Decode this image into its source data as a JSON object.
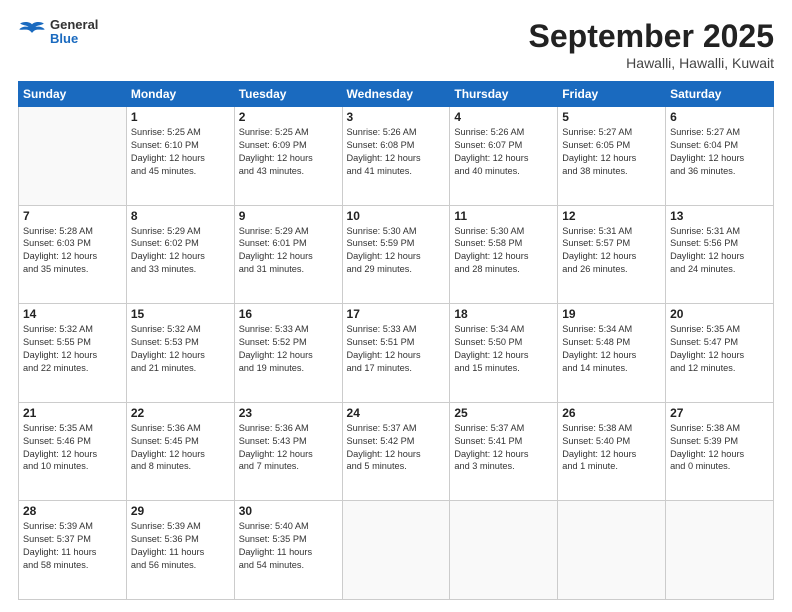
{
  "header": {
    "logo_line1": "General",
    "logo_line2": "Blue",
    "month": "September 2025",
    "location": "Hawalli, Hawalli, Kuwait"
  },
  "weekdays": [
    "Sunday",
    "Monday",
    "Tuesday",
    "Wednesday",
    "Thursday",
    "Friday",
    "Saturday"
  ],
  "weeks": [
    [
      {
        "day": "",
        "info": ""
      },
      {
        "day": "1",
        "info": "Sunrise: 5:25 AM\nSunset: 6:10 PM\nDaylight: 12 hours\nand 45 minutes."
      },
      {
        "day": "2",
        "info": "Sunrise: 5:25 AM\nSunset: 6:09 PM\nDaylight: 12 hours\nand 43 minutes."
      },
      {
        "day": "3",
        "info": "Sunrise: 5:26 AM\nSunset: 6:08 PM\nDaylight: 12 hours\nand 41 minutes."
      },
      {
        "day": "4",
        "info": "Sunrise: 5:26 AM\nSunset: 6:07 PM\nDaylight: 12 hours\nand 40 minutes."
      },
      {
        "day": "5",
        "info": "Sunrise: 5:27 AM\nSunset: 6:05 PM\nDaylight: 12 hours\nand 38 minutes."
      },
      {
        "day": "6",
        "info": "Sunrise: 5:27 AM\nSunset: 6:04 PM\nDaylight: 12 hours\nand 36 minutes."
      }
    ],
    [
      {
        "day": "7",
        "info": "Sunrise: 5:28 AM\nSunset: 6:03 PM\nDaylight: 12 hours\nand 35 minutes."
      },
      {
        "day": "8",
        "info": "Sunrise: 5:29 AM\nSunset: 6:02 PM\nDaylight: 12 hours\nand 33 minutes."
      },
      {
        "day": "9",
        "info": "Sunrise: 5:29 AM\nSunset: 6:01 PM\nDaylight: 12 hours\nand 31 minutes."
      },
      {
        "day": "10",
        "info": "Sunrise: 5:30 AM\nSunset: 5:59 PM\nDaylight: 12 hours\nand 29 minutes."
      },
      {
        "day": "11",
        "info": "Sunrise: 5:30 AM\nSunset: 5:58 PM\nDaylight: 12 hours\nand 28 minutes."
      },
      {
        "day": "12",
        "info": "Sunrise: 5:31 AM\nSunset: 5:57 PM\nDaylight: 12 hours\nand 26 minutes."
      },
      {
        "day": "13",
        "info": "Sunrise: 5:31 AM\nSunset: 5:56 PM\nDaylight: 12 hours\nand 24 minutes."
      }
    ],
    [
      {
        "day": "14",
        "info": "Sunrise: 5:32 AM\nSunset: 5:55 PM\nDaylight: 12 hours\nand 22 minutes."
      },
      {
        "day": "15",
        "info": "Sunrise: 5:32 AM\nSunset: 5:53 PM\nDaylight: 12 hours\nand 21 minutes."
      },
      {
        "day": "16",
        "info": "Sunrise: 5:33 AM\nSunset: 5:52 PM\nDaylight: 12 hours\nand 19 minutes."
      },
      {
        "day": "17",
        "info": "Sunrise: 5:33 AM\nSunset: 5:51 PM\nDaylight: 12 hours\nand 17 minutes."
      },
      {
        "day": "18",
        "info": "Sunrise: 5:34 AM\nSunset: 5:50 PM\nDaylight: 12 hours\nand 15 minutes."
      },
      {
        "day": "19",
        "info": "Sunrise: 5:34 AM\nSunset: 5:48 PM\nDaylight: 12 hours\nand 14 minutes."
      },
      {
        "day": "20",
        "info": "Sunrise: 5:35 AM\nSunset: 5:47 PM\nDaylight: 12 hours\nand 12 minutes."
      }
    ],
    [
      {
        "day": "21",
        "info": "Sunrise: 5:35 AM\nSunset: 5:46 PM\nDaylight: 12 hours\nand 10 minutes."
      },
      {
        "day": "22",
        "info": "Sunrise: 5:36 AM\nSunset: 5:45 PM\nDaylight: 12 hours\nand 8 minutes."
      },
      {
        "day": "23",
        "info": "Sunrise: 5:36 AM\nSunset: 5:43 PM\nDaylight: 12 hours\nand 7 minutes."
      },
      {
        "day": "24",
        "info": "Sunrise: 5:37 AM\nSunset: 5:42 PM\nDaylight: 12 hours\nand 5 minutes."
      },
      {
        "day": "25",
        "info": "Sunrise: 5:37 AM\nSunset: 5:41 PM\nDaylight: 12 hours\nand 3 minutes."
      },
      {
        "day": "26",
        "info": "Sunrise: 5:38 AM\nSunset: 5:40 PM\nDaylight: 12 hours\nand 1 minute."
      },
      {
        "day": "27",
        "info": "Sunrise: 5:38 AM\nSunset: 5:39 PM\nDaylight: 12 hours\nand 0 minutes."
      }
    ],
    [
      {
        "day": "28",
        "info": "Sunrise: 5:39 AM\nSunset: 5:37 PM\nDaylight: 11 hours\nand 58 minutes."
      },
      {
        "day": "29",
        "info": "Sunrise: 5:39 AM\nSunset: 5:36 PM\nDaylight: 11 hours\nand 56 minutes."
      },
      {
        "day": "30",
        "info": "Sunrise: 5:40 AM\nSunset: 5:35 PM\nDaylight: 11 hours\nand 54 minutes."
      },
      {
        "day": "",
        "info": ""
      },
      {
        "day": "",
        "info": ""
      },
      {
        "day": "",
        "info": ""
      },
      {
        "day": "",
        "info": ""
      }
    ]
  ]
}
